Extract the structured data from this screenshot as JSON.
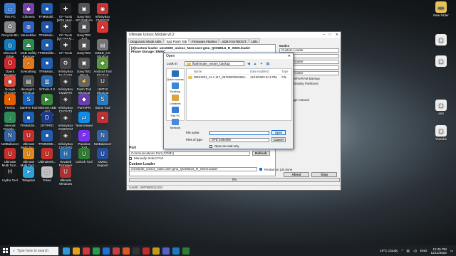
{
  "desktop_icons": [
    {
      "label": "This PC",
      "color": "#3a7bd5",
      "glyph": "▭"
    },
    {
      "label": "Chimera",
      "color": "#7a3fb0",
      "glyph": "◆"
    },
    {
      "label": "TFMMobil...",
      "color": "#1f5fb5",
      "glyph": "■"
    },
    {
      "label": "CF-Tools [MTK Mod...",
      "color": "#222",
      "glyph": "✚"
    },
    {
      "label": "EasyTBG SP Platform",
      "color": "#555",
      "glyph": "▣"
    },
    {
      "label": "InfinityBox CM2SCR",
      "color": "#c33",
      "glyph": "◉"
    },
    {
      "label": "Recycle Bin",
      "color": "#888",
      "glyph": "♻"
    },
    {
      "label": "IntuneBlue",
      "color": "#2d63c8",
      "glyph": "◍"
    },
    {
      "label": "TFMMobi...",
      "color": "#2255aa",
      "glyph": "■"
    },
    {
      "label": "CF-Tools [QCOM M...",
      "color": "#333",
      "glyph": "✚"
    },
    {
      "label": "EasyTBG Tool",
      "color": "#555",
      "glyph": "▣"
    },
    {
      "label": "",
      "color": "#d33",
      "glyph": "▲"
    },
    {
      "label": "Microsoft Edge",
      "color": "#0f7dc2",
      "glyph": "◎"
    },
    {
      "label": "USB Safely Remove",
      "color": "#2c8f4c",
      "glyph": "⏏"
    },
    {
      "label": "TFMMobile...",
      "color": "#1f5fb5",
      "glyph": "■"
    },
    {
      "label": "CF-Tools",
      "color": "#333",
      "glyph": "✚"
    },
    {
      "label": "EasyTBG",
      "color": "#555",
      "glyph": "▣"
    },
    {
      "label": "DB&B_8.0 Shortcut",
      "color": "#777",
      "glyph": "▤"
    },
    {
      "label": "Opera Browser",
      "color": "#d4252c",
      "glyph": "O"
    },
    {
      "label": "Everything",
      "color": "#e07a1f",
      "glyph": "⌕"
    },
    {
      "label": "TFMMobi...",
      "color": "#1f5fb5",
      "glyph": "■"
    },
    {
      "label": "InfinityBox Tool MTK",
      "color": "#444",
      "glyph": "⚙"
    },
    {
      "label": "EasyTBG Pro 2",
      "color": "#555",
      "glyph": "▣"
    },
    {
      "label": "Android Tool Shortcut",
      "color": "#5b9c3a",
      "glyph": "◆"
    },
    {
      "label": "Google Chrome",
      "color": "#dd4b39",
      "glyph": "◉"
    },
    {
      "label": "devmgmt - Shortcut",
      "color": "#555",
      "glyph": "▤"
    },
    {
      "label": "SiTools 3.2",
      "color": "#2b6cb0",
      "glyph": "▥"
    },
    {
      "label": "InfinityBox CM2MTK",
      "color": "#333",
      "glyph": "◈"
    },
    {
      "label": "Flash Tool Shortcut",
      "color": "#666",
      "glyph": "⚡"
    },
    {
      "label": "UMTv2 Shortcut",
      "color": "#3b3b3b",
      "glyph": "U"
    },
    {
      "label": "Firefox",
      "color": "#e66000",
      "glyph": "◐"
    },
    {
      "label": "SamFw Tool",
      "color": "#1565c0",
      "glyph": "S"
    },
    {
      "label": "Minimal ADB and Fastboot",
      "color": "#3b8a3b",
      "glyph": "▶"
    },
    {
      "label": "InfinityBox CM2MT2",
      "color": "#333",
      "glyph": "◈"
    },
    {
      "label": "PureVPN",
      "color": "#6a3fb0",
      "glyph": "◆"
    },
    {
      "label": "Sams Tool",
      "color": "#2a7bc0",
      "glyph": "S"
    },
    {
      "label": "Internet Downlo...",
      "color": "#2e8b57",
      "glyph": "↓"
    },
    {
      "label": "TFMMOBI...",
      "color": "#1f5fb5",
      "glyph": "■"
    },
    {
      "label": "DFTPRO",
      "color": "#1e3a8a",
      "glyph": "D"
    },
    {
      "label": "InfinityBox CM2QCM",
      "color": "#333",
      "glyph": "◈"
    },
    {
      "label": "TeamViewer",
      "color": "#0e8ee9",
      "glyph": "⇄"
    },
    {
      "label": "",
      "color": "#b33",
      "glyph": "●"
    },
    {
      "label": "NetBalancer",
      "color": "#3465a4",
      "glyph": "N"
    },
    {
      "label": "Ultimate Multi Too...",
      "color": "#c9302c",
      "glyph": "U"
    },
    {
      "label": "TFMMOBI...",
      "color": "#1f5fb5",
      "glyph": "■"
    },
    {
      "label": "InfinityBox CM2SPD",
      "color": "#333",
      "glyph": "◈"
    },
    {
      "label": "Pandora Tool",
      "color": "#7b2ff7",
      "glyph": "P"
    },
    {
      "label": "NetBalancer",
      "color": "#3465a4",
      "glyph": "N"
    },
    {
      "label": "Ultimate Multi Tool...",
      "color": "#c9302c",
      "glyph": "U"
    },
    {
      "label": "Ultimate Multi Tool...",
      "color": "#e08a1e",
      "glyph": "U"
    },
    {
      "label": "UltimateMi...",
      "color": "#c9302c",
      "glyph": "U"
    },
    {
      "label": "Hovatek Firmware",
      "color": "#2b6cb0",
      "glyph": "H"
    },
    {
      "label": "Unlock Tool",
      "color": "#2e7d32",
      "glyph": "U"
    },
    {
      "label": "UMSU Support",
      "color": "#2450a0",
      "glyph": "U"
    },
    {
      "label": "Hydra Tool",
      "color": "#1b1b1b",
      "glyph": "H"
    },
    {
      "label": "Telegram",
      "color": "#2aa3dd",
      "glyph": "➤"
    },
    {
      "label": "Tokan",
      "color": "#c2c2c2",
      "glyph": "▢"
    },
    {
      "label": "Ultimate Windows",
      "color": "#b03030",
      "glyph": "U"
    }
  ],
  "right_icons": [
    {
      "label": "New folder",
      "color": "#e8c35a",
      "glyph": "▬"
    },
    {
      "label": "",
      "color": "#eeeeee",
      "glyph": "▢"
    },
    {
      "label": "",
      "color": "#eeeeee",
      "glyph": "▢"
    },
    {
      "label": "amt",
      "color": "#eeeeee",
      "glyph": "▢"
    },
    {
      "label": "Youtube",
      "color": "#eeeeee",
      "glyph": "▢"
    }
  ],
  "app": {
    "title": "Ultimate Unisoc Module v0.2",
    "tabs": [
      "Diagnostic Mode Utils",
      "Spd Flash Tab",
      "Firmware Flasher",
      "ADB FASTBOOT",
      "Utils"
    ],
    "active_tab": 1,
    "log_lines": [
      "[3]Custom loader: ums9230_unisoc_Nuts-user-gmu_QOGBIL6_R_SIGN.loader",
      "Phone Storage: EMMC"
    ],
    "right": {
      "modes_title": "Modes",
      "loader_label": "Custom Loader",
      "field1": "",
      "field2": "Read by loader",
      "field3": "",
      "field4": "Read by loader",
      "backup_label": "SRAM/NVRAM Backup",
      "display_partitions": "Display Partitions",
      "storage_manual": "Storage manual"
    },
    "port_title": "Port",
    "port_value": "Communications Port (COM1)",
    "refresh_label": "Refresh",
    "manual_port": "Manually Select Port",
    "custom_loader_title": "Custom Loader",
    "custom_loader_value": "ums9230_unisoc_Nuts-user-gmu_QOGBIL6_R_SIGN.loader",
    "restart_label": "Restart on job done",
    "about_label": "About",
    "stop_label": "Stop",
    "progress": 0,
    "progress_text": "0%",
    "status": "Card0: UMT9802(1122)"
  },
  "dialog": {
    "title": "Open",
    "lookin_label": "Look in:",
    "lookin_value": "flashmode_nvram_backup",
    "places": [
      {
        "label": "Quick access",
        "color": "#2a6fb5"
      },
      {
        "label": "Desktop",
        "color": "#3a86d8"
      },
      {
        "label": "Libraries",
        "color": "#d9a441"
      },
      {
        "label": "This PC",
        "color": "#3a7bd5"
      },
      {
        "label": "Network",
        "color": "#4a8ad4"
      }
    ],
    "columns": [
      "Name",
      "Date modified",
      "Type"
    ],
    "files": [
      {
        "name": "RMX3231_11.A.117_36740002031861...",
        "date": "11/10/2023 8:12 PM",
        "type": "File"
      }
    ],
    "filename_label": "File name:",
    "filename_value": "",
    "filetype_label": "Files of type:",
    "filetype_value": "SPD Sn9x9S9",
    "readonly_label": "Open as read-only",
    "open_label": "Open",
    "cancel_label": "Cancel"
  },
  "taskbar": {
    "search_placeholder": "Type here to search",
    "apps": [
      "#2b9ad6",
      "#e6a11a",
      "#d03a3a",
      "#2a9d4a",
      "#1e6fd9",
      "#c23f3f",
      "#e0571e",
      "#333333",
      "#c02b2b",
      "#c59a1a",
      "#5560c9",
      "#1b79c1",
      "#2f7d32"
    ],
    "weather": "19°C Cloudy",
    "lang": "ENG",
    "time": "12:45 PM",
    "date": "11/12/2023"
  }
}
